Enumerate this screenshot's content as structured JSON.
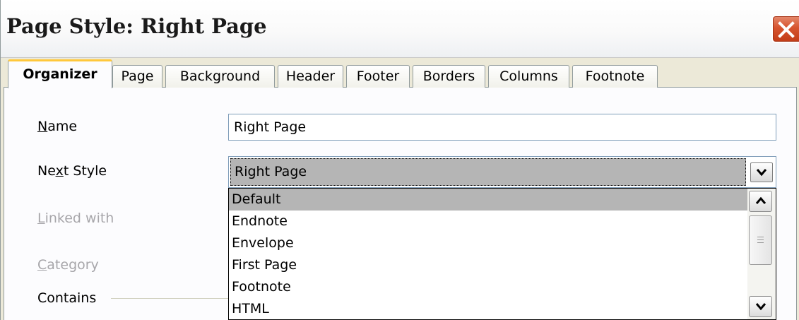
{
  "dialog": {
    "title": "Page Style: Right Page"
  },
  "tabs": [
    {
      "label": "Organizer",
      "active": true
    },
    {
      "label": "Page"
    },
    {
      "label": "Background"
    },
    {
      "label": "Header"
    },
    {
      "label": "Footer"
    },
    {
      "label": "Borders"
    },
    {
      "label": "Columns"
    },
    {
      "label": "Footnote"
    }
  ],
  "form": {
    "name": {
      "label_mnemonic": "N",
      "label_rest": "ame",
      "value": "Right Page"
    },
    "next_style": {
      "label_before": "Ne",
      "label_mnemonic": "x",
      "label_after": "t Style",
      "value": "Right Page"
    },
    "linked_with": {
      "label_mnemonic": "L",
      "label_rest": "inked with"
    },
    "category": {
      "label_mnemonic": "C",
      "label_rest": "ategory"
    },
    "contains": {
      "label": "Contains"
    }
  },
  "dropdown": {
    "options": [
      "Default",
      "Endnote",
      "Envelope",
      "First Page",
      "Footnote",
      "HTML"
    ],
    "highlighted": "Default"
  },
  "colors": {
    "dialog_bg": "#ece9d8",
    "close_button": "#d7542f",
    "active_tab_accent": "#ffc83c",
    "selection": "#b5b5b5"
  },
  "icons": [
    "close-icon",
    "chevron-down-icon",
    "scroll-up-icon",
    "scroll-down-icon"
  ]
}
